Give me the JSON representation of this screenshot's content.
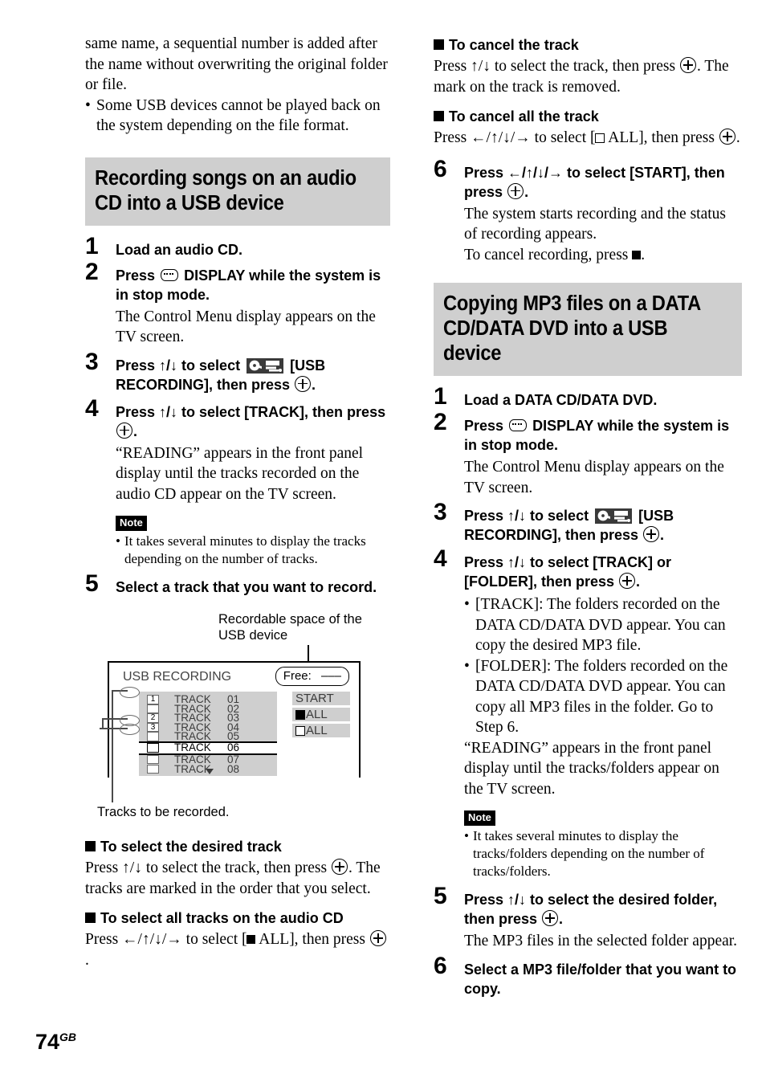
{
  "page": {
    "number": "74",
    "region": "GB"
  },
  "left_column": {
    "intro_paragraph": "same name, a sequential number is added after the name without overwriting the original folder or file.",
    "intro_bullets": [
      "Some USB devices cannot be played back on the system depending on the file format."
    ],
    "section_heading_line1": "Recording songs on an audio",
    "section_heading_line2": "CD into a USB device",
    "steps": [
      {
        "number": "1",
        "head_part1": "Load an audio CD.",
        "head_part2": "",
        "desc": ""
      },
      {
        "number": "2",
        "head_part1": "Press",
        "head_part2": "DISPLAY while the system is in stop mode.",
        "desc": "The Control Menu display appears on the TV screen."
      },
      {
        "number": "3",
        "head_part1": "Press ↑/↓ to select",
        "head_part2": "[USB RECORDING], then press",
        "head_part3": ".",
        "desc": ""
      },
      {
        "number": "4",
        "head_part1": "Press ↑/↓ to select [TRACK], then press",
        "head_part2": ".",
        "desc": "“READING” appears in the front panel display until the tracks recorded on the audio CD appear on the TV screen."
      },
      {
        "number": "5",
        "head_part1": "Select a track that you want to record.",
        "head_part2": "",
        "desc": ""
      }
    ],
    "note": {
      "label": "Note",
      "items": [
        "It takes several minutes to display the tracks depending on the number of tracks."
      ]
    },
    "subsections": [
      {
        "title": "To select the desired track",
        "body_part1": "Press ↑/↓ to select the track, then press",
        "body_part2": ". The tracks are marked in the order that you select."
      },
      {
        "title": "To select all tracks on the audio CD",
        "body_part1": "Press ←/↑/↓/→ to select [",
        "body_part2": " ALL], then press",
        "body_part3": "."
      }
    ]
  },
  "diagram": {
    "caption_top": "Recordable space of the USB device",
    "caption_bottom": "Tracks to be recorded.",
    "screen_title": "USB RECORDING",
    "free_label": "Free:",
    "free_value": "–––",
    "track_rows": [
      {
        "mark": "1",
        "name": "TRACK",
        "number": "01",
        "selected": false
      },
      {
        "mark": "",
        "name": "TRACK",
        "number": "02",
        "selected": false
      },
      {
        "mark": "2",
        "name": "TRACK",
        "number": "03",
        "selected": false
      },
      {
        "mark": "3",
        "name": "TRACK",
        "number": "04",
        "selected": false
      },
      {
        "mark": "",
        "name": "TRACK",
        "number": "05",
        "selected": false
      },
      {
        "mark": "",
        "name": "TRACK",
        "number": "06",
        "selected": true
      },
      {
        "mark": "",
        "name": "TRACK",
        "number": "07",
        "selected": false
      },
      {
        "mark": "",
        "name": "TRACK",
        "number": "08",
        "selected": false
      }
    ],
    "buttons": [
      {
        "label": "START",
        "marker": "none"
      },
      {
        "label": "ALL",
        "marker": "filled"
      },
      {
        "label": "ALL",
        "marker": "open"
      }
    ]
  },
  "right_column": {
    "subsections_top": [
      {
        "title": "To cancel the track",
        "body_part1": "Press ↑/↓ to select the track, then press",
        "body_part2": ". The mark on the track is removed."
      },
      {
        "title": "To cancel all the track",
        "body_part1": "Press ←/↑/↓/→ to select [",
        "body_part2": " ALL], then press",
        "body_part3": "."
      }
    ],
    "step6_recording": {
      "number": "6",
      "head_part1": "Press ←/↑/↓/→ to select [START], then press",
      "head_part2": ".",
      "desc1": "The system starts recording and the status of recording appears.",
      "desc2_prefix": "To cancel recording, press",
      "desc2_suffix": "."
    },
    "section_heading_line1": "Copying MP3 files on a DATA",
    "section_heading_line2": "CD/DATA DVD into a USB device",
    "steps": [
      {
        "number": "1",
        "head_part1": "Load a DATA CD/DATA DVD.",
        "desc": ""
      },
      {
        "number": "2",
        "head_part1": "Press",
        "head_part2": "DISPLAY while the system is in stop mode.",
        "desc": "The Control Menu display appears on the TV screen."
      },
      {
        "number": "3",
        "head_part1": "Press ↑/↓ to select",
        "head_part2": "[USB RECORDING], then press",
        "head_part3": ".",
        "desc": ""
      },
      {
        "number": "4",
        "head_part1": "Press ↑/↓ to select [TRACK] or [FOLDER], then press",
        "head_part2": ".",
        "bullets": [
          "[TRACK]: The folders recorded on the DATA CD/DATA DVD appear. You can copy the desired MP3 file.",
          "[FOLDER]: The folders recorded on the DATA CD/DATA DVD appear. You can copy all MP3 files in the folder. Go to Step 6."
        ],
        "desc": "“READING” appears in the front panel display until the tracks/folders appear on the TV screen."
      },
      {
        "number": "5",
        "head_part1": "Press ↑/↓ to select the desired folder, then press",
        "head_part2": ".",
        "desc": "The MP3 files in the selected folder appear."
      },
      {
        "number": "6",
        "head_part1": "Select a MP3 file/folder that you want to copy.",
        "desc": ""
      }
    ],
    "note": {
      "label": "Note",
      "items": [
        "It takes several minutes to display the tracks/folders depending on the number of tracks/folders."
      ]
    }
  },
  "colors": {
    "heading_band": "#cfcfcf",
    "panel_gray": "#cfcfcf",
    "icon_dark": "#3a3a3a",
    "text": "#000000"
  }
}
